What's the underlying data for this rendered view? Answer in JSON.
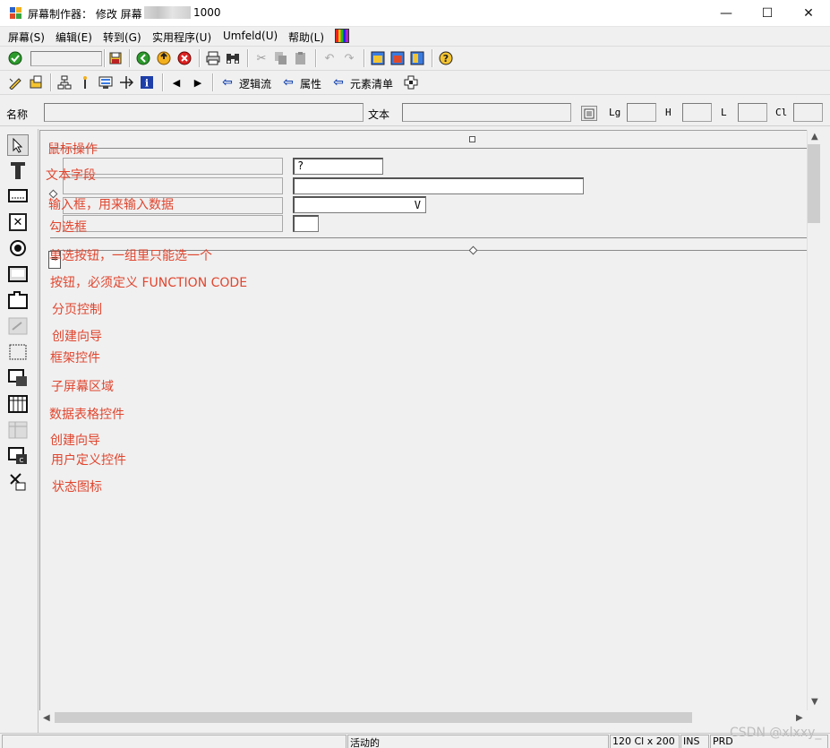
{
  "title": {
    "text": "屏幕制作器：  修改 屏幕",
    "number": "1000"
  },
  "window_controls": {
    "minimize": "—",
    "maximize": "☐",
    "close": "✕"
  },
  "menu": [
    "屏幕(S)",
    "编辑(E)",
    "转到(G)",
    "实用程序(U)",
    "Umfeld(U)",
    "帮助(L)"
  ],
  "toolbar2": {
    "logic_flow": "逻辑流",
    "attributes": "属性",
    "element_list": "元素清单"
  },
  "fields": {
    "name_label": "名称",
    "text_label": "文本",
    "lg_label": "Lg",
    "h_label": "H",
    "l_label": "L",
    "cl_label": "Cl"
  },
  "canvas": {
    "input1_value": "?",
    "dropdown_value": "V",
    "button_text": "="
  },
  "annotations": [
    "鼠标操作",
    "文本字段",
    "输入框，用来输入数据",
    "勾选框",
    "单选按钮，一组里只能选一个",
    "按钮，必须定义 FUNCTION CODE",
    "分页控制",
    "创建向导",
    "框架控件",
    "子屏幕区域",
    "数据表格控件",
    "创建向导",
    "用户定义控件",
    "状态图标"
  ],
  "status": {
    "state": "活动的",
    "size": "120 Cl x 200",
    "mode": "INS",
    "system": "PRD"
  },
  "watermark": "CSDN @xlxxy_",
  "colors": {
    "annotation": "#e0452e",
    "title_bg": "#ffffff",
    "toolbar_bg": "#f0f0f0"
  }
}
